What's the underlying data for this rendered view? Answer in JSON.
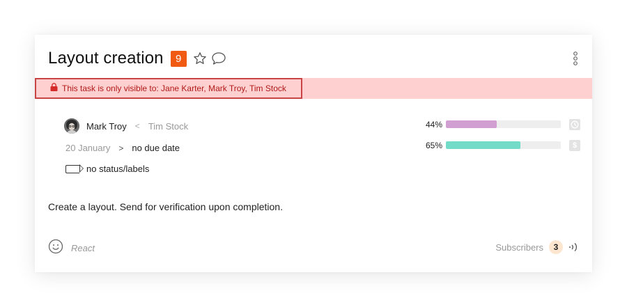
{
  "task": {
    "title": "Layout creation",
    "badge_count": "9",
    "favorite_icon": "star-outline-icon",
    "comment_icon": "speech-bubble-icon",
    "menu_icon": "vertical-dots-icon"
  },
  "visibility": {
    "icon": "lock-icon",
    "text": "This task is only visible to: Jane Karter, Mark Troy, Tim Stock",
    "color": "#b01818",
    "background": "#ffd0d0"
  },
  "people": {
    "assignee": "Mark Troy",
    "separator": "<",
    "author": "Tim Stock"
  },
  "dates": {
    "start": "20 January",
    "separator": ">",
    "due": "no due date"
  },
  "status": {
    "icon": "label-tag-icon",
    "text": "no status/labels"
  },
  "progress": [
    {
      "label": "44%",
      "value": 0.44,
      "color": "#d29fd2",
      "icon": "clock-icon"
    },
    {
      "label": "65%",
      "value": 0.65,
      "color": "#72dcc8",
      "icon": "dollar-icon"
    }
  ],
  "description": "Create a layout. Send for verification upon completion.",
  "footer": {
    "react_icon": "smiley-icon",
    "react_label": "React",
    "subscribers_label": "Subscribers",
    "subscribers_count": "3",
    "subscribe_icon": "broadcast-icon"
  },
  "colors": {
    "accent": "#f05a12",
    "subscriber_badge": "#fde6cf"
  }
}
